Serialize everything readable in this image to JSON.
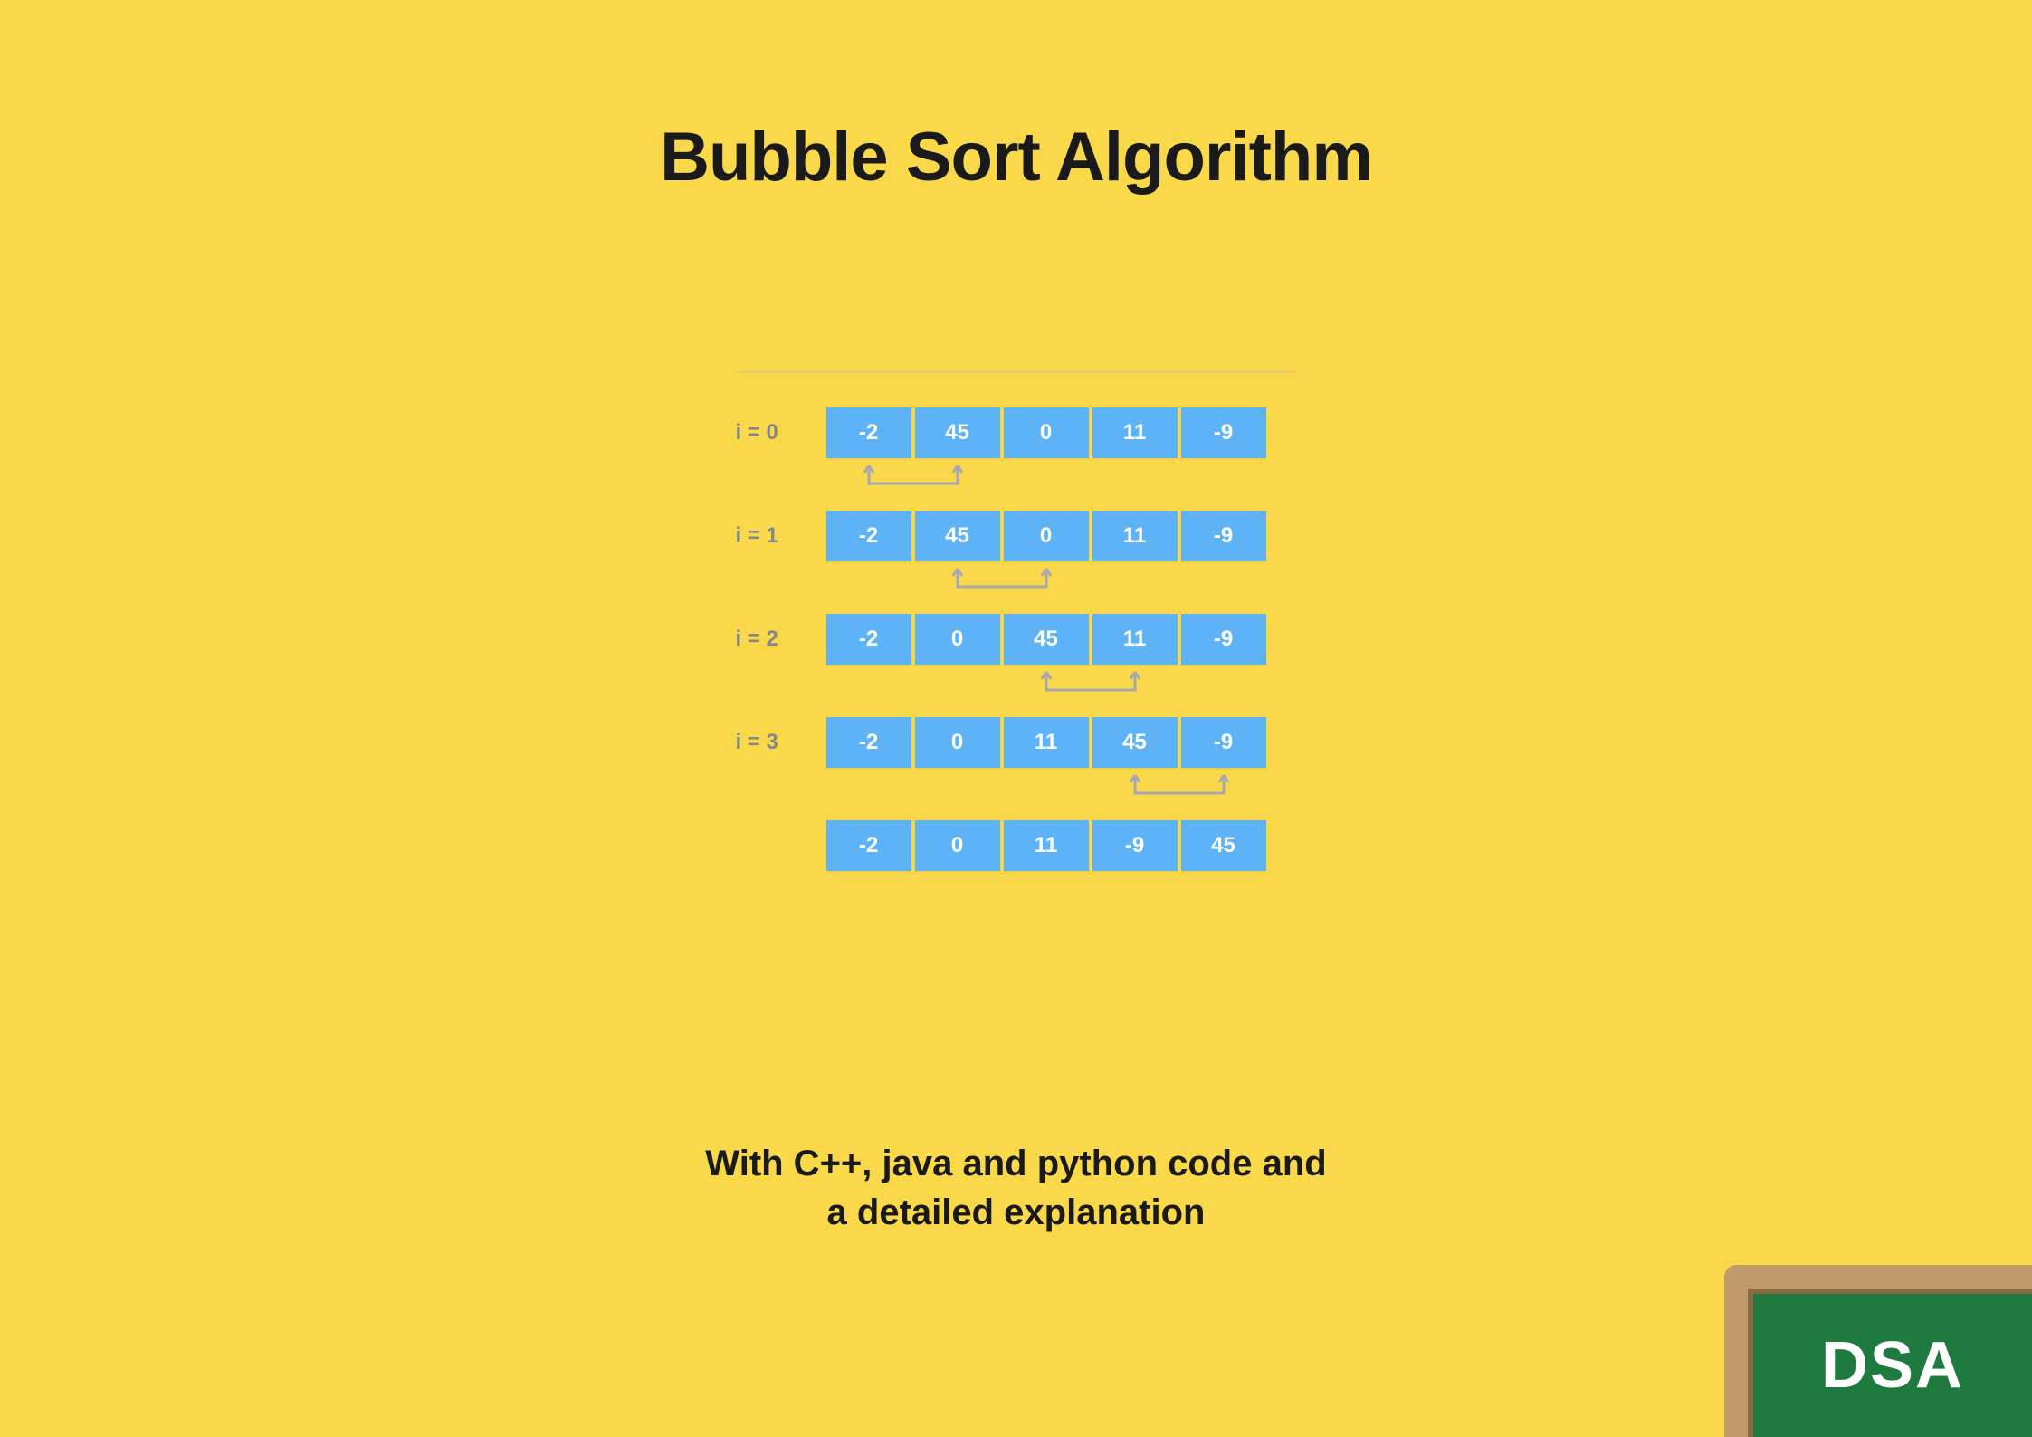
{
  "title": "Bubble Sort Algorithm",
  "subtitle_line1": "With C++, java and python  code and",
  "subtitle_line2": "a detailed explanation",
  "badge": "DSA",
  "steps": [
    {
      "label": "i = 0",
      "values": [
        "-2",
        "45",
        "0",
        "11",
        "-9"
      ],
      "swap_between": [
        0,
        1
      ]
    },
    {
      "label": "i = 1",
      "values": [
        "-2",
        "45",
        "0",
        "11",
        "-9"
      ],
      "swap_between": [
        1,
        2
      ]
    },
    {
      "label": "i = 2",
      "values": [
        "-2",
        "0",
        "45",
        "11",
        "-9"
      ],
      "swap_between": [
        2,
        3
      ]
    },
    {
      "label": "i = 3",
      "values": [
        "-2",
        "0",
        "11",
        "45",
        "-9"
      ],
      "swap_between": [
        3,
        4
      ]
    },
    {
      "label": "",
      "values": [
        "-2",
        "0",
        "11",
        "-9",
        "45"
      ],
      "swap_between": null
    }
  ],
  "colors": {
    "background": "#f9d949",
    "cell": "#5eb3f6",
    "arrow": "#a8a8b0",
    "board_frame": "#c19a6b",
    "board_green": "#1e7a3e"
  }
}
